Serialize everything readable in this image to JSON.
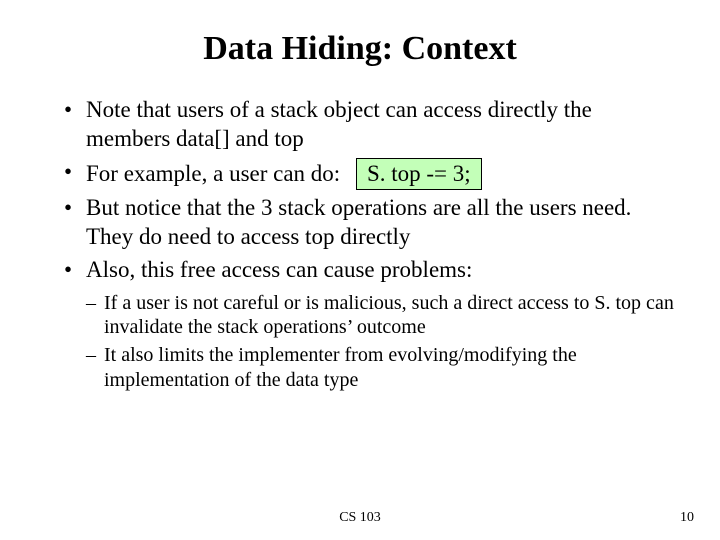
{
  "title": "Data Hiding: Context",
  "bullets": {
    "b1": "Note that users of a stack object can access directly the members data[] and top",
    "b2_lead": "For example, a user can do:",
    "b2_code": "S. top -= 3;",
    "b3": "But notice that the 3 stack operations are all the users need. They do need to access top directly",
    "b4": "Also, this free access can cause problems:"
  },
  "subs": {
    "s1": "If a user is not careful or is malicious, such a direct access to S. top can invalidate the stack operations’ outcome",
    "s2": "It also limits the implementer from evolving/modifying the implementation of the data type"
  },
  "footer": {
    "course": "CS 103",
    "page": "10"
  }
}
